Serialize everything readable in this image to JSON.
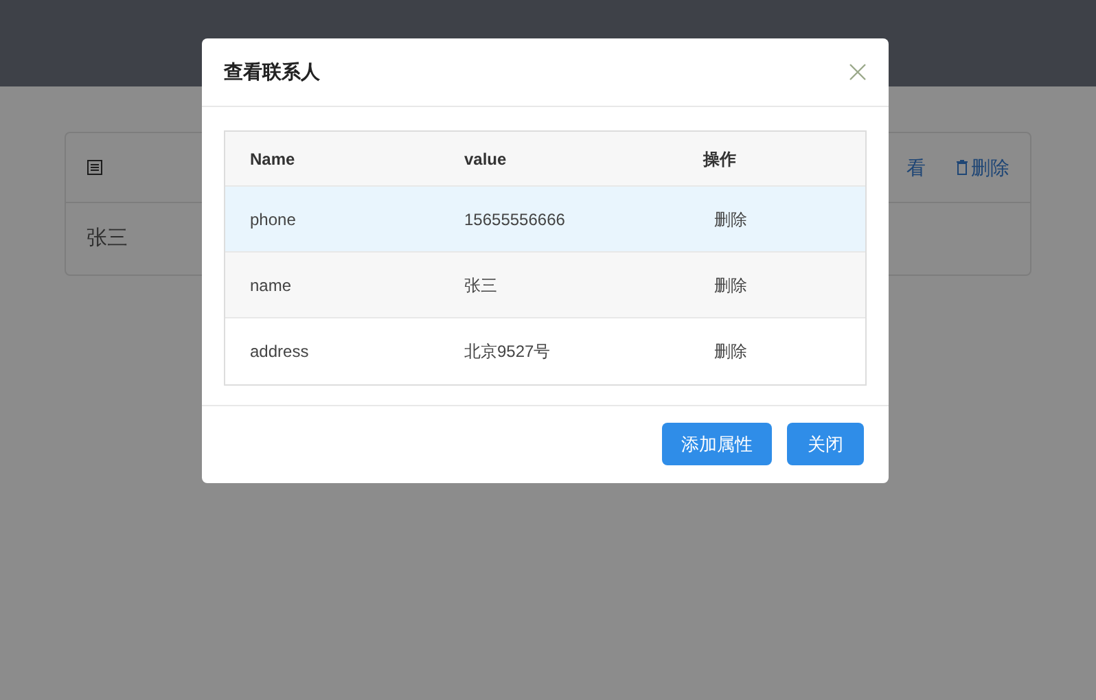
{
  "page": {
    "card": {
      "actions": [
        "看",
        "删除"
      ],
      "rows": [
        "张三"
      ]
    }
  },
  "dialog": {
    "title": "查看联系人",
    "table": {
      "columns": [
        "Name",
        "value",
        "操作"
      ],
      "rows": [
        {
          "name": "phone",
          "value": "15655556666",
          "action": "删除",
          "hovered": true
        },
        {
          "name": "name",
          "value": "张三",
          "action": "删除",
          "hovered": false
        },
        {
          "name": "address",
          "value": "北京9527号",
          "action": "删除",
          "hovered": false
        }
      ]
    },
    "buttons": [
      "添加属性",
      "关闭"
    ]
  }
}
